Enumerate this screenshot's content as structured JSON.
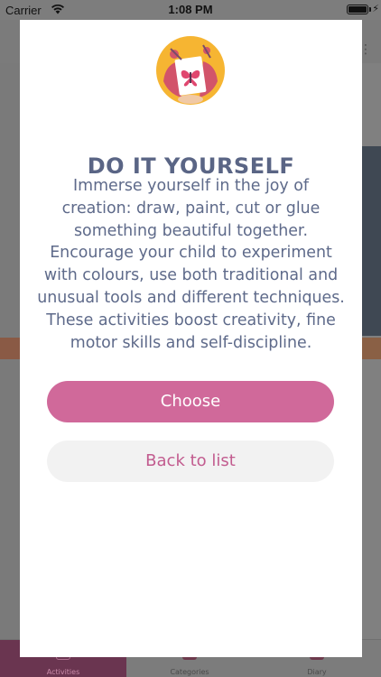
{
  "status_bar": {
    "carrier": "Carrier",
    "time": "1:08 PM",
    "battery_level": 1.0,
    "charging_icon": "bolt-icon",
    "wifi_icon": "wifi-icon"
  },
  "background": {
    "menu_icon": "more-vertical-icon"
  },
  "tab_bar": {
    "tabs": [
      {
        "label": "Activities",
        "icon": "activities-icon",
        "selected": true
      },
      {
        "label": "Categories",
        "icon": "categories-icon",
        "selected": false
      },
      {
        "label": "Diary",
        "icon": "diary-icon",
        "selected": false
      }
    ]
  },
  "modal": {
    "icon": "diy-craft-icon",
    "title": "DO IT YOURSELF",
    "description": "Immerse yourself in the joy of creation: draw, paint, cut or glue something beautiful together. Encourage your child to experiment with colours, use both traditional and unusual tools and different techniques. These activities boost creativity, fine motor skills and self-discipline.",
    "primary_button": "Choose",
    "secondary_button": "Back to list"
  },
  "colors": {
    "accent": "#d0699a",
    "title": "#5a6585",
    "secondary_button_bg": "#f2f2f2",
    "secondary_button_text": "#c25c8f"
  }
}
